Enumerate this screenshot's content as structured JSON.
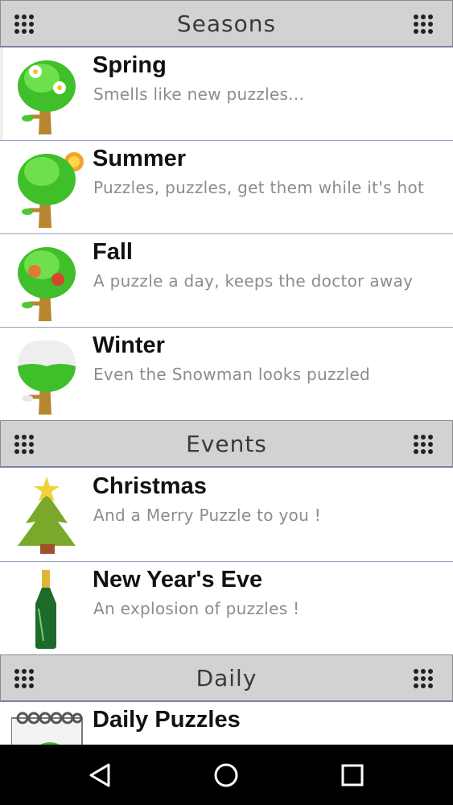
{
  "sections": {
    "seasons": "Seasons",
    "events": "Events",
    "daily": "Daily"
  },
  "items": {
    "spring": {
      "title": "Spring",
      "subtitle": "Smells like new puzzles..."
    },
    "summer": {
      "title": "Summer",
      "subtitle": "Puzzles, puzzles, get them while it's hot"
    },
    "fall": {
      "title": "Fall",
      "subtitle": "A puzzle a day, keeps the doctor away"
    },
    "winter": {
      "title": "Winter",
      "subtitle": "Even the Snowman looks puzzled"
    },
    "christmas": {
      "title": "Christmas",
      "subtitle": "And a Merry Puzzle to you !"
    },
    "newyear": {
      "title": "New Year's Eve",
      "subtitle": "An explosion of puzzles !"
    },
    "daily": {
      "title": "Daily Puzzles"
    }
  },
  "navbar": {
    "icons": [
      "back-icon",
      "home-icon",
      "recents-icon"
    ]
  },
  "colors": {
    "header_bg": "#d2d2d4",
    "divider": "#9aa0c4",
    "leaf": "#3fbf2a",
    "trunk": "#b8862f"
  }
}
